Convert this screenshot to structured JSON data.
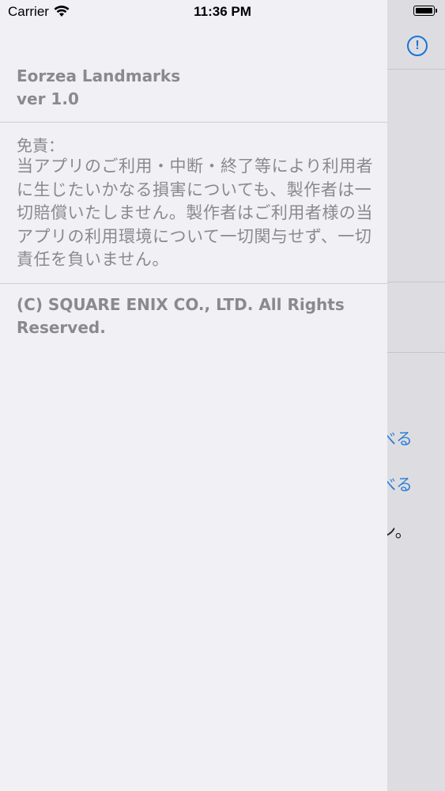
{
  "status_bar": {
    "carrier": "Carrier",
    "time": "11:36 PM"
  },
  "drawer": {
    "app_name": "Eorzea Landmarks",
    "version": "ver 1.0",
    "disclaimer_title": "免責：",
    "disclaimer_body": "当アプリのご利用・中断・終了等により利用者に生じたいかなる損害についても、製作者は一切賠償いたしません。製作者はご利用者様の当アプリの利用環境について一切関与せず、一切責任を負いません。",
    "copyright": "(C) SQUARE ENIX CO., LTD. All Rights Reserved."
  },
  "background_view": {
    "link_fragment_1": "べる",
    "link_fragment_2": "べる",
    "text_fragment": "ン。"
  },
  "colors": {
    "accent": "#1a73d9",
    "drawer_bg": "#f0f0f5",
    "secondary_text": "#8a8a8e"
  },
  "icons": {
    "wifi": "wifi-icon",
    "battery": "battery-icon",
    "info": "info-icon"
  }
}
